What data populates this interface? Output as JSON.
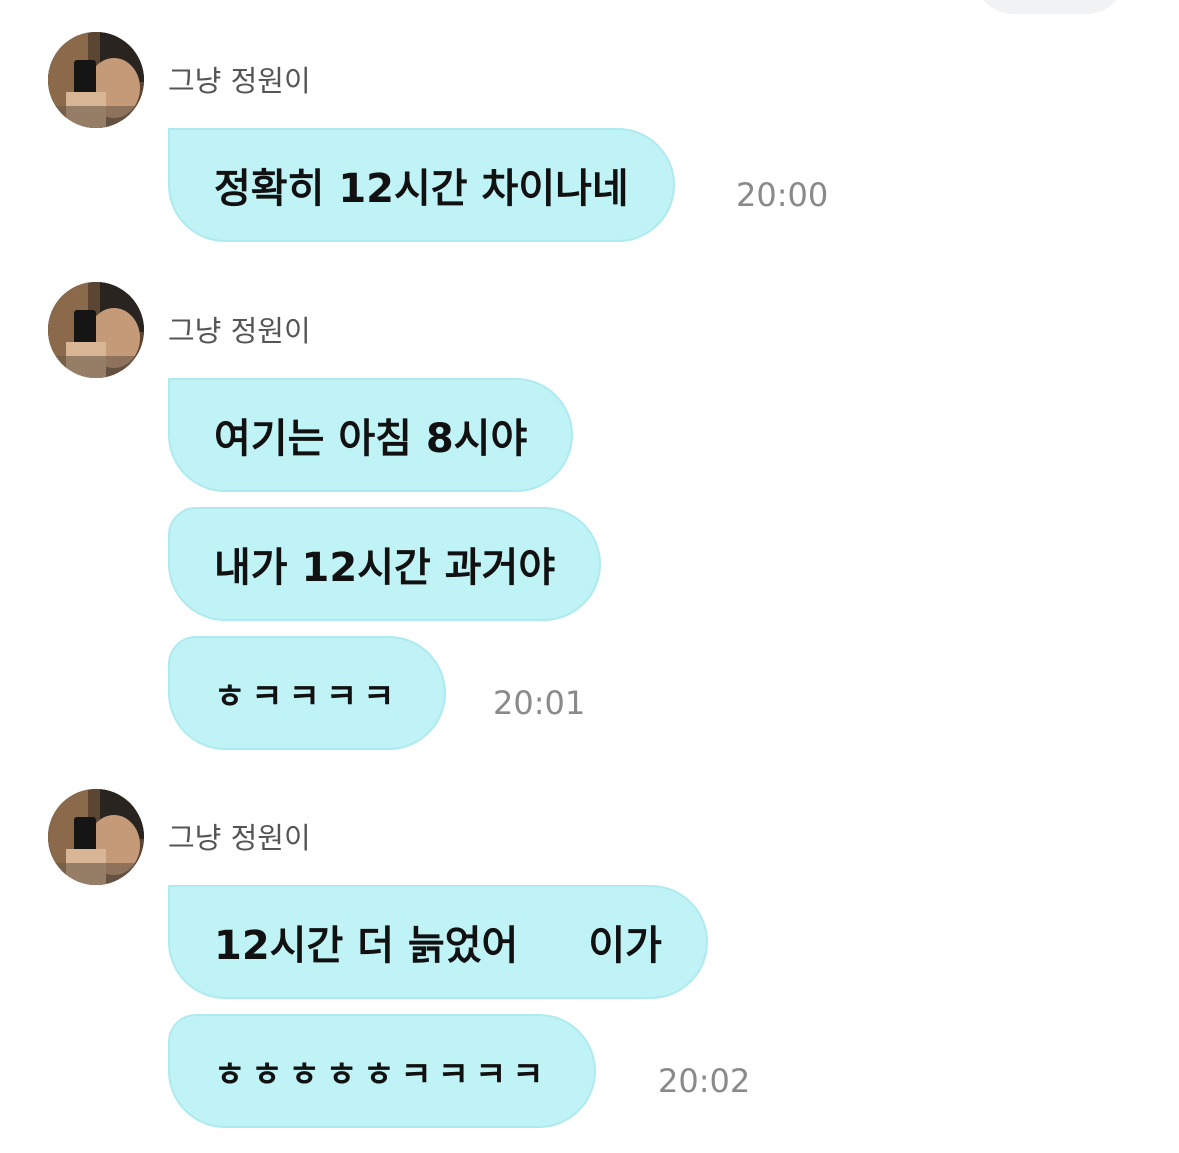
{
  "chat": {
    "groups": [
      {
        "sender": "그냥 정원이",
        "messages": [
          {
            "text": "정확히 12시간 차이나네"
          }
        ],
        "time": "20:00"
      },
      {
        "sender": "그냥 정원이",
        "messages": [
          {
            "text": "여기는 아침 8시야"
          },
          {
            "text": "내가 12시간 과거야"
          },
          {
            "text": "ㅎㅋㅋㅋㅋ"
          }
        ],
        "time": "20:01"
      },
      {
        "sender": "그냥 정원이",
        "messages": [
          {
            "text": "12시간 더 늙었어",
            "text_tail": "이가"
          },
          {
            "text": "ㅎㅎㅎㅎㅎㅋㅋㅋㅋ"
          }
        ],
        "time": "20:02"
      }
    ]
  },
  "colors": {
    "bubble_fill": "#bff3f6",
    "bubble_border": "#aeeaf0",
    "time_text": "#8a8a8a",
    "sender_text": "#555555"
  },
  "icons": {
    "avatar": "profile-photo-icon"
  }
}
